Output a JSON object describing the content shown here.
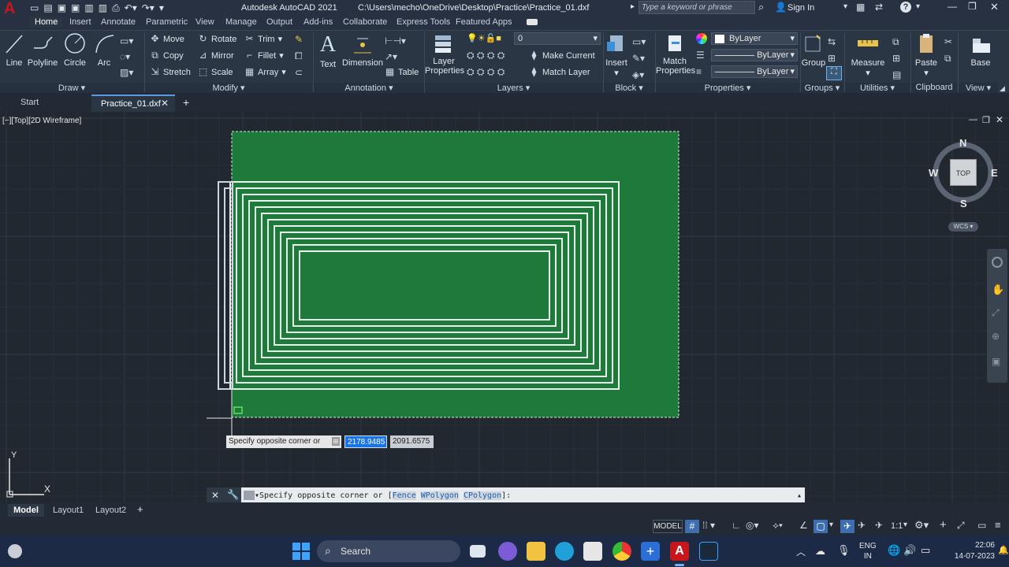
{
  "title_bar": {
    "app_title": "Autodesk AutoCAD 2021",
    "file_path": "C:\\Users\\mecho\\OneDrive\\Desktop\\Practice\\Practice_01.dxf",
    "search_placeholder": "Type a keyword or phrase",
    "sign_in": "Sign In"
  },
  "ribbon_tabs": [
    "Home",
    "Insert",
    "Annotate",
    "Parametric",
    "View",
    "Manage",
    "Output",
    "Add-ins",
    "Collaborate",
    "Express Tools",
    "Featured Apps"
  ],
  "ribbon": {
    "draw": {
      "line": "Line",
      "polyline": "Polyline",
      "circle": "Circle",
      "arc": "Arc",
      "label": "Draw"
    },
    "modify": {
      "move": "Move",
      "rotate": "Rotate",
      "trim": "Trim",
      "copy": "Copy",
      "mirror": "Mirror",
      "fillet": "Fillet",
      "stretch": "Stretch",
      "scale": "Scale",
      "array": "Array",
      "label": "Modify"
    },
    "annotation": {
      "text": "Text",
      "dimension": "Dimension",
      "table": "Table",
      "label": "Annotation"
    },
    "layers": {
      "layer_properties_1": "Layer",
      "layer_properties_2": "Properties",
      "current_layer": "0",
      "make_current": "Make Current",
      "match_layer": "Match Layer",
      "label": "Layers"
    },
    "block": {
      "insert": "Insert",
      "label": "Block"
    },
    "properties": {
      "match_1": "Match",
      "match_2": "Properties",
      "color": "ByLayer",
      "linetype": "ByLayer",
      "lineweight": "ByLayer",
      "label": "Properties"
    },
    "groups": {
      "group": "Group",
      "label": "Groups"
    },
    "utilities": {
      "measure": "Measure",
      "label": "Utilities"
    },
    "clipboard": {
      "paste": "Paste",
      "label": "Clipboard"
    },
    "view": {
      "base": "Base",
      "label": "View"
    }
  },
  "doc_tabs": {
    "start": "Start",
    "active": "Practice_01.dxf"
  },
  "viewport": {
    "label": "[−][Top][2D Wireframe]",
    "viewcube": {
      "north": "N",
      "south": "S",
      "east": "E",
      "west": "W",
      "top": "TOP",
      "wcs": "WCS"
    },
    "ucs": {
      "y": "Y",
      "x": "X"
    }
  },
  "tooltip": {
    "prompt": "Specify opposite corner or",
    "value_x": "2178.9485",
    "value_y": "2091.6575"
  },
  "command_line": {
    "text": "Specify opposite corner or [",
    "opt1": "Fence",
    "opt2": "WPolygon",
    "opt3": "CPolygon",
    "end": "]:"
  },
  "layout_tabs": [
    "Model",
    "Layout1",
    "Layout2"
  ],
  "status": {
    "model": "MODEL",
    "scale": "1:1"
  },
  "taskbar": {
    "search": "Search",
    "lang_1": "ENG",
    "lang_2": "IN",
    "time": "22:06",
    "date": "14-07-2023"
  },
  "colors": {
    "selection_fill": "#1e7a3a",
    "accent": "#0a84ff",
    "autocad_red": "#c7161c"
  }
}
